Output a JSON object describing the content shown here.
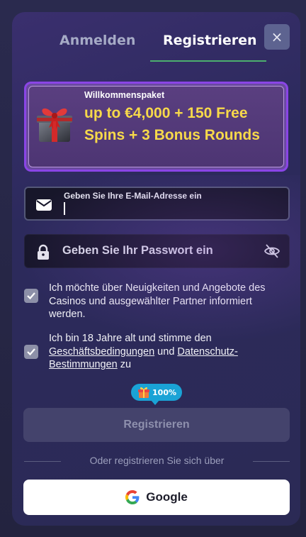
{
  "tabs": {
    "login": "Anmelden",
    "register": "Registrieren"
  },
  "close_icon": "×",
  "promo": {
    "label": "Willkommenspaket",
    "title": "up to €4,000 + 150 Free Spins + 3 Bonus Rounds"
  },
  "email": {
    "label": "Geben Sie Ihre E-Mail-Adresse ein",
    "value": ""
  },
  "password": {
    "placeholder": "Geben Sie Ihr Passwort ein"
  },
  "consent_news": {
    "checked": true,
    "text": "Ich möchte über Neuigkeiten und Angebote des Casinos und ausgewählter Partner informiert werden."
  },
  "consent_terms": {
    "checked": true,
    "prefix": "Ich bin 18 Jahre alt und stimme den ",
    "terms_link": "Geschäftsbedingungen",
    "middle": " und ",
    "privacy_link": "Datenschutz-Bestimmungen",
    "suffix": " zu"
  },
  "badge": {
    "progress": "100%"
  },
  "submit_label": "Registrieren",
  "divider_text": "Oder registrieren Sie sich über",
  "google": {
    "label": "Google"
  },
  "colors": {
    "accent_green": "#4caf6e",
    "promo_gold": "#f7d94a",
    "promo_border": "#8a45e6",
    "badge_blue": "#1aa3d6"
  }
}
